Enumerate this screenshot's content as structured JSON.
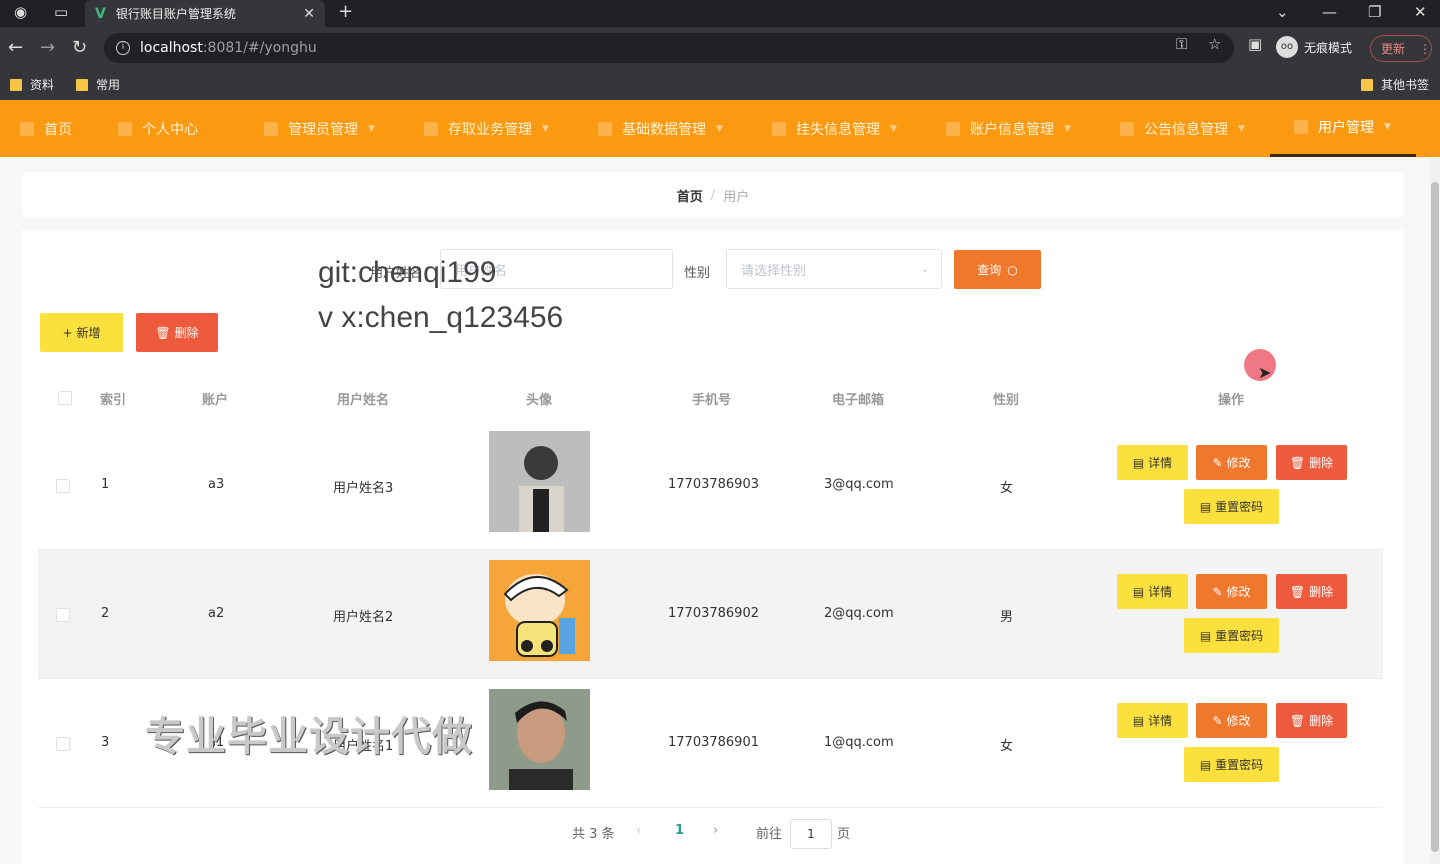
{
  "browser": {
    "tab_title": "银行账目账户管理系统",
    "url_host": "localhost",
    "url_path": ":8081/#/yonghu",
    "profile_label": "无痕模式",
    "update_label": "更新",
    "bookmarks": [
      "资料",
      "常用"
    ],
    "other_bookmarks": "其他书签"
  },
  "nav": {
    "items": [
      {
        "label": "首页"
      },
      {
        "label": "个人中心"
      },
      {
        "label": "管理员管理"
      },
      {
        "label": "存取业务管理"
      },
      {
        "label": "基础数据管理"
      },
      {
        "label": "挂失信息管理"
      },
      {
        "label": "账户信息管理"
      },
      {
        "label": "公告信息管理"
      },
      {
        "label": "用户管理"
      }
    ],
    "active": "用户管理"
  },
  "breadcrumb": {
    "home": "首页",
    "current": "用户"
  },
  "search": {
    "name_label": "用户姓名",
    "name_placeholder": "用户姓名",
    "gender_label": "性别",
    "gender_placeholder": "请选择性别",
    "query_button": "查询"
  },
  "toolbar": {
    "add_label": "新增",
    "delete_label": "删除"
  },
  "table": {
    "headers": [
      "索引",
      "账户",
      "用户姓名",
      "头像",
      "手机号",
      "电子邮箱",
      "性别",
      "操作"
    ],
    "rows": [
      {
        "index": "1",
        "account": "a3",
        "name": "用户姓名3",
        "phone": "17703786903",
        "email": "3@qq.com",
        "gender": "女"
      },
      {
        "index": "2",
        "account": "a2",
        "name": "用户姓名2",
        "phone": "17703786902",
        "email": "2@qq.com",
        "gender": "男"
      },
      {
        "index": "3",
        "account": "a1",
        "name": "用户姓名1",
        "phone": "17703786901",
        "email": "1@qq.com",
        "gender": "女"
      }
    ],
    "actions": {
      "detail": "详情",
      "edit": "修改",
      "delete": "删除",
      "reset": "重置密码"
    }
  },
  "pagination": {
    "total": "共 3 条",
    "current_page": "1",
    "goto_label": "前往",
    "goto_value": "1",
    "page_suffix": "页"
  },
  "overlay": {
    "watermark_line1": "git:chenqi199",
    "watermark_line2": "v x:chen_q123456",
    "watermark_big": "专业毕业设计代做"
  },
  "colors": {
    "nav_bg": "#fb9a11",
    "query": "#f0782c",
    "add": "#fce13e",
    "delete": "#ee5a3c"
  }
}
